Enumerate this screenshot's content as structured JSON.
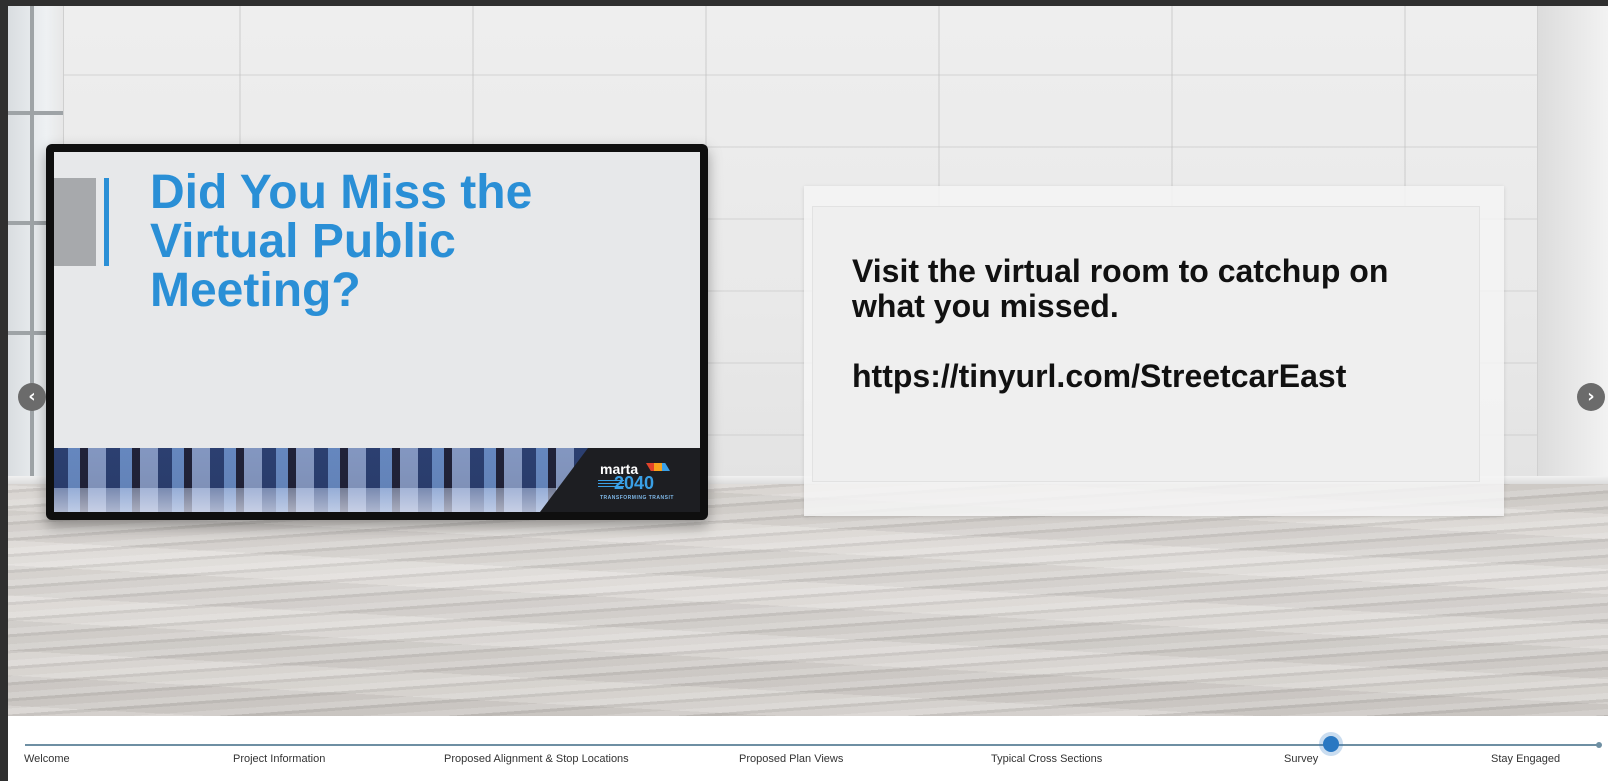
{
  "slide": {
    "title": "Did You Miss the\nVirtual Public\nMeeting?",
    "logo_word": "marta",
    "logo_number": "2040",
    "logo_tagline": "TRANSFORMING TRANSIT"
  },
  "panel": {
    "line1": "Visit the virtual room to catchup on what you missed.",
    "link": "https://tinyurl.com/StreetcarEast"
  },
  "navigation": {
    "prev_glyph": "‹",
    "next_glyph": "›"
  },
  "timeline": {
    "items": [
      {
        "label": "Welcome"
      },
      {
        "label": "Project Information"
      },
      {
        "label": "Proposed Alignment & Stop Locations"
      },
      {
        "label": "Proposed Plan Views"
      },
      {
        "label": "Typical Cross Sections"
      },
      {
        "label": "Survey"
      },
      {
        "label": "Stay Engaged"
      }
    ],
    "current": "Survey",
    "accent_color": "#2a78c2"
  },
  "colors": {
    "slide_title": "#2a8fd6",
    "panel_text": "#111111"
  },
  "icons": {
    "prev": "chevron-left-icon",
    "next": "chevron-right-icon"
  }
}
